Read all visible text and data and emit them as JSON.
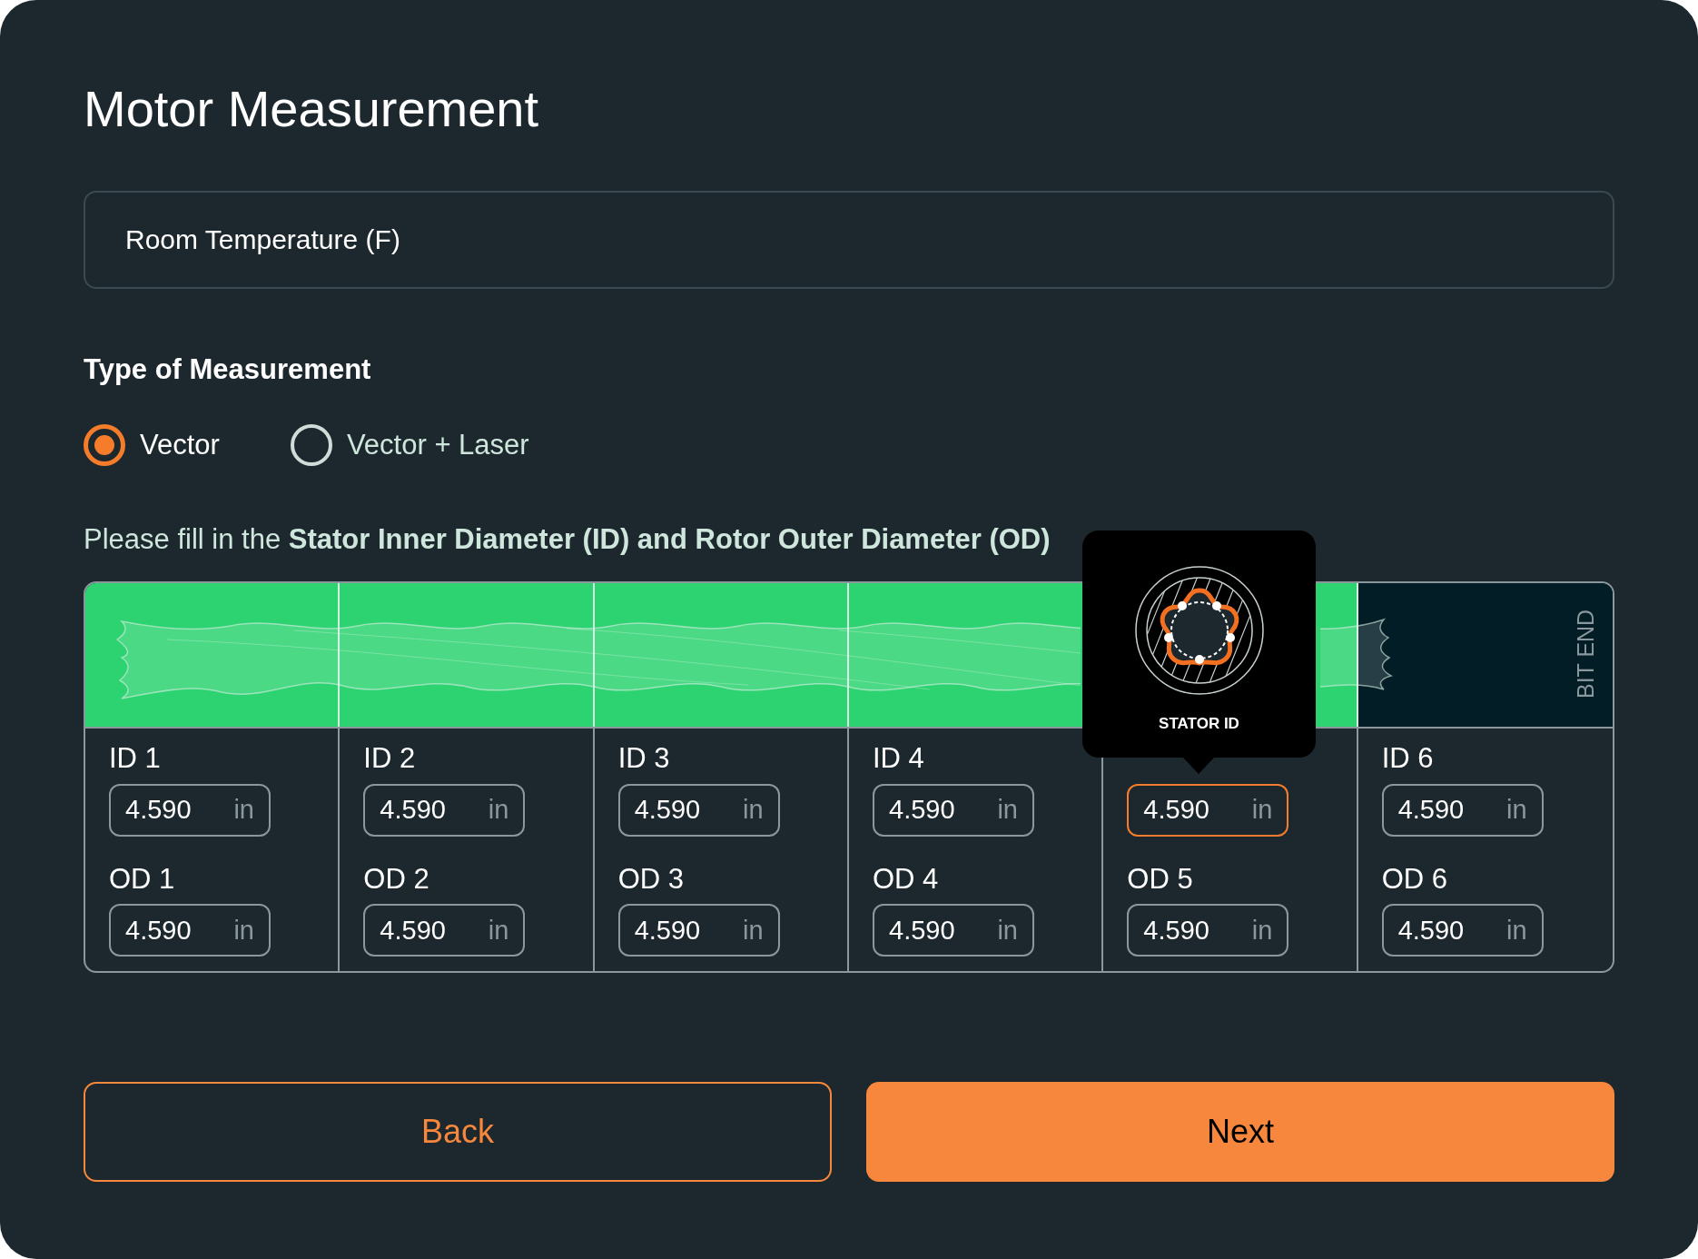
{
  "title": "Motor Measurement",
  "room_temperature": {
    "placeholder": "Room Temperature (F)"
  },
  "measurement_type": {
    "label": "Type of Measurement",
    "options": [
      {
        "label": "Vector",
        "selected": true
      },
      {
        "label": "Vector + Laser",
        "selected": false
      }
    ]
  },
  "instruction": "Please fill in the **Stator Inner Diameter (ID) and Rotor Outer Diameter (OD)**",
  "sections": [
    {
      "highlighted": true,
      "id_label": "ID 1",
      "id_value": "4.590",
      "id_unit": "in",
      "id_focused": false,
      "od_label": "OD 1",
      "od_value": "4.590",
      "od_unit": "in"
    },
    {
      "highlighted": true,
      "id_label": "ID 2",
      "id_value": "4.590",
      "id_unit": "in",
      "id_focused": false,
      "od_label": "OD 2",
      "od_value": "4.590",
      "od_unit": "in"
    },
    {
      "highlighted": true,
      "id_label": "ID 3",
      "id_value": "4.590",
      "id_unit": "in",
      "id_focused": false,
      "od_label": "OD 3",
      "od_value": "4.590",
      "od_unit": "in"
    },
    {
      "highlighted": true,
      "id_label": "ID 4",
      "id_value": "4.590",
      "id_unit": "in",
      "id_focused": false,
      "od_label": "OD 4",
      "od_value": "4.590",
      "od_unit": "in"
    },
    {
      "highlighted": true,
      "id_value": "4.590",
      "id_unit": "in",
      "id_focused": true,
      "od_label": "OD 5",
      "od_value": "4.590",
      "od_unit": "in"
    },
    {
      "highlighted": false,
      "end_label": "BIT END",
      "id_label": "ID 6",
      "id_value": "4.590",
      "id_unit": "in",
      "id_focused": false,
      "od_label": "OD 6",
      "od_value": "4.590",
      "od_unit": "in"
    }
  ],
  "tooltip": {
    "label": "STATOR ID"
  },
  "buttons": [
    {
      "label": "Back",
      "kind": "outline"
    },
    {
      "label": "Next",
      "kind": "primary"
    }
  ]
}
